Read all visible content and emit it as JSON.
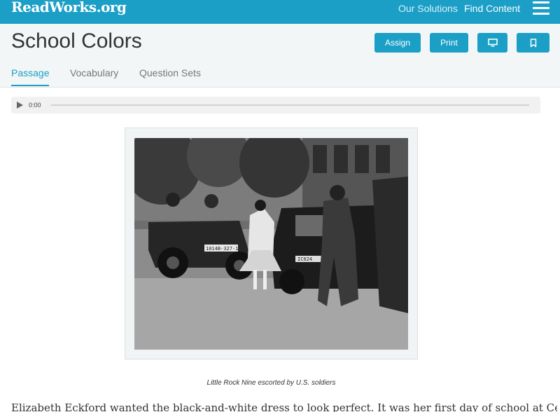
{
  "topbar": {
    "logo": "ReadWorks.org",
    "nav": [
      "Our Solutions",
      "Find Content"
    ],
    "menu_icon": "hamburger-menu-icon"
  },
  "header": {
    "title": "School Colors",
    "buttons": {
      "assign": "Assign",
      "print": "Print",
      "present_icon": "monitor-icon",
      "bookmark_icon": "bookmark-icon"
    },
    "tabs": [
      "Passage",
      "Vocabulary",
      "Question Sets"
    ],
    "active_tab": "Passage"
  },
  "audio": {
    "time": "0:00",
    "play_icon": "play-icon"
  },
  "figure": {
    "caption": "Little Rock Nine escorted by U.S. soldiers",
    "jeep_plate": "1014B-327-1",
    "car_plate": "IC024"
  },
  "passage": {
    "first_line": "Elizabeth Eckford wanted the black-and-white dress to look perfect. It was her first day of school at Central High"
  }
}
